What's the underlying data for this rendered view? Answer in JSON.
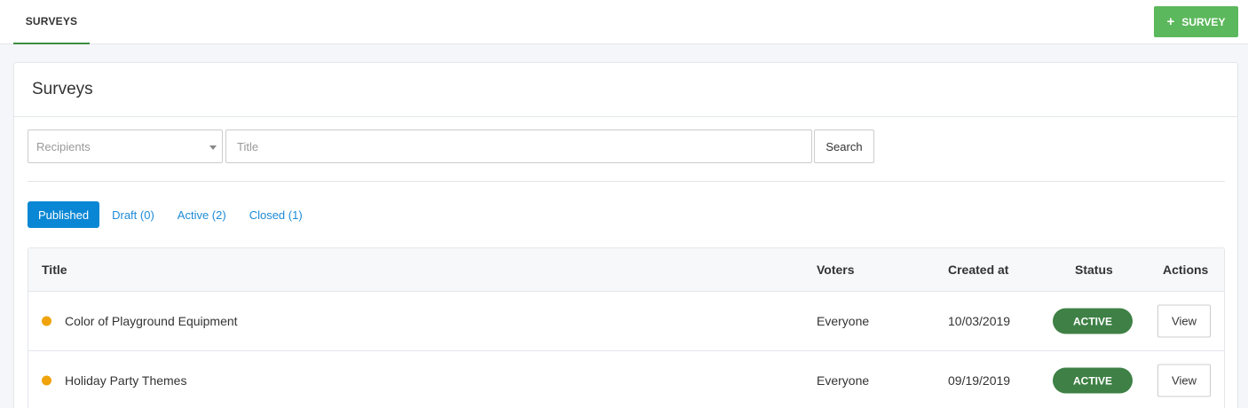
{
  "topbar": {
    "tab_label": "SURVEYS",
    "add_button_icon": "plus-icon",
    "add_button_label": "SURVEY"
  },
  "card": {
    "title": "Surveys"
  },
  "filters": {
    "recipients_placeholder": "Recipients",
    "title_placeholder": "Title",
    "search_label": "Search"
  },
  "status_tabs": [
    {
      "label": "Published",
      "active": true
    },
    {
      "label": "Draft (0)",
      "active": false
    },
    {
      "label": "Active (2)",
      "active": false
    },
    {
      "label": "Closed (1)",
      "active": false
    }
  ],
  "table": {
    "headers": {
      "title": "Title",
      "voters": "Voters",
      "created_at": "Created at",
      "status": "Status",
      "actions": "Actions"
    },
    "rows": [
      {
        "title": "Color of Playground Equipment",
        "voters": "Everyone",
        "created_at": "10/03/2019",
        "status": "ACTIVE",
        "action": "View"
      },
      {
        "title": "Holiday Party Themes",
        "voters": "Everyone",
        "created_at": "09/19/2019",
        "status": "ACTIVE",
        "action": "View"
      }
    ]
  },
  "colors": {
    "accent_green": "#5cb85c",
    "tab_underline": "#3e8e41",
    "active_badge": "#3e8045",
    "primary_blue": "#0a87d4",
    "status_dot": "#f0a30a"
  }
}
